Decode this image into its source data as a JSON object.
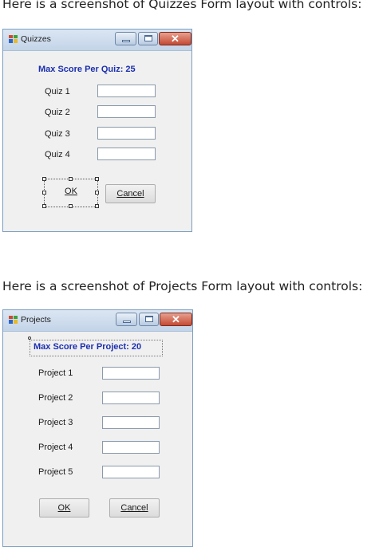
{
  "captions": {
    "quizzes": "Here is a screenshot of Quizzes Form layout with controls:",
    "projects": "Here is a screenshot of Projects Form layout with controls:"
  },
  "quizzes_form": {
    "title": "Quizzes",
    "heading": "Max Score Per Quiz: 25",
    "fields": [
      {
        "label": "Quiz 1",
        "value": ""
      },
      {
        "label": "Quiz 2",
        "value": ""
      },
      {
        "label": "Quiz 3",
        "value": ""
      },
      {
        "label": "Quiz 4",
        "value": ""
      }
    ],
    "ok_label": "OK",
    "cancel_label": "Cancel",
    "close_glyph": "✕"
  },
  "projects_form": {
    "title": "Projects",
    "heading": "Max Score Per Project: 20",
    "fields": [
      {
        "label": "Project 1",
        "value": ""
      },
      {
        "label": "Project 2",
        "value": ""
      },
      {
        "label": "Project 3",
        "value": ""
      },
      {
        "label": "Project 4",
        "value": ""
      },
      {
        "label": "Project 5",
        "value": ""
      }
    ],
    "ok_label": "OK",
    "cancel_label": "Cancel",
    "close_glyph": "✕"
  },
  "colors": {
    "heading": "#1b2fb0",
    "titlebar": "#c3d4e8",
    "close_button": "#c44a33"
  }
}
